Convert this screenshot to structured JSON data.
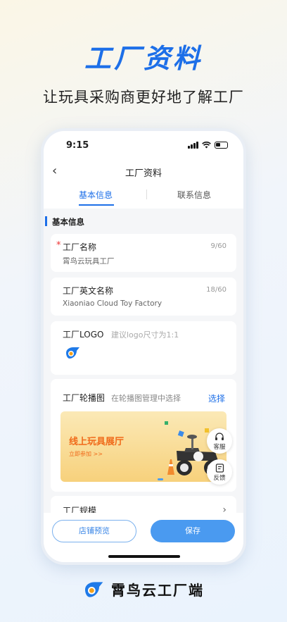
{
  "promo": {
    "title": "工厂资料",
    "subtitle": "让玩具采购商更好地了解工厂"
  },
  "status_bar": {
    "time": "9:15"
  },
  "nav": {
    "title": "工厂资料"
  },
  "tabs": [
    {
      "label": "基本信息",
      "active": true
    },
    {
      "label": "联系信息",
      "active": false
    }
  ],
  "section": {
    "label": "基本信息"
  },
  "fields": {
    "factory_name": {
      "label": "工厂名称",
      "required_mark": "*",
      "value": "霄鸟云玩具工厂",
      "counter": "9/60"
    },
    "english_name": {
      "label": "工厂英文名称",
      "value": "Xiaoniao Cloud Toy Factory",
      "counter": "18/60"
    },
    "logo": {
      "label": "工厂LOGO",
      "hint": "建议logo尺寸为1:1",
      "icon": "bird-logo-icon"
    },
    "carousel": {
      "label": "工厂轮播图",
      "hint": "在轮播图管理中选择",
      "action": "选择"
    },
    "scale": {
      "label": "工厂规模"
    }
  },
  "banner": {
    "title": "线上玩具展厅",
    "link": "立即参加 >>"
  },
  "float_buttons": [
    {
      "label": "客服",
      "icon": "headset-icon"
    },
    {
      "label": "反馈",
      "icon": "feedback-icon"
    }
  ],
  "bottom": {
    "preview_label": "店铺预览",
    "save_label": "保存"
  },
  "brand": {
    "name": "霄鸟云工厂端"
  },
  "colors": {
    "accent": "#1d6fe8",
    "button": "#4a9af0",
    "required": "#e33333"
  }
}
